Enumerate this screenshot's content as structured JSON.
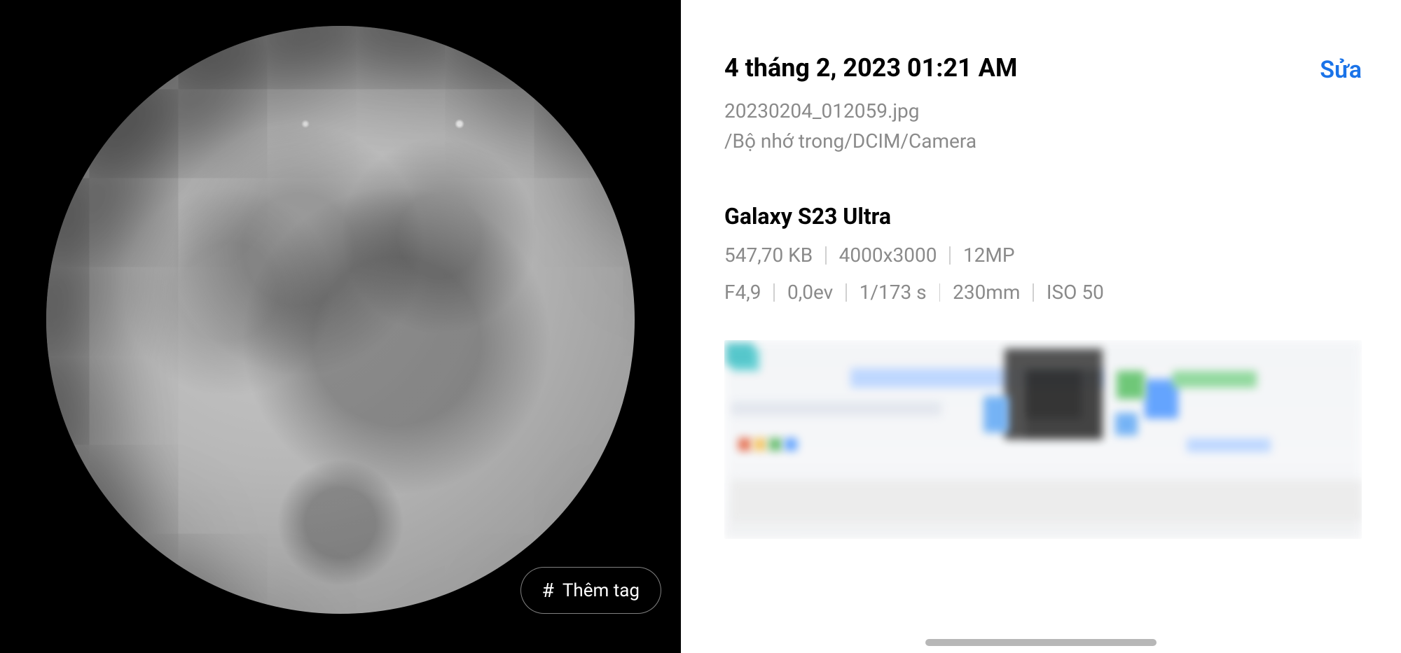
{
  "image": {
    "add_tag_label": "Thêm tag"
  },
  "details": {
    "date_title": "4 tháng 2, 2023 01:21 AM",
    "edit_label": "Sửa",
    "filename": "20230204_012059.jpg",
    "filepath": "/Bộ nhớ trong/DCIM/Camera",
    "device": "Galaxy S23 Ultra",
    "file_meta": {
      "size": "547,70 KB",
      "dimensions": "4000x3000",
      "megapixels": "12MP"
    },
    "exif": {
      "aperture": "F4,9",
      "ev": "0,0ev",
      "shutter": "1/173 s",
      "focal": "230mm",
      "iso": "ISO 50"
    }
  }
}
